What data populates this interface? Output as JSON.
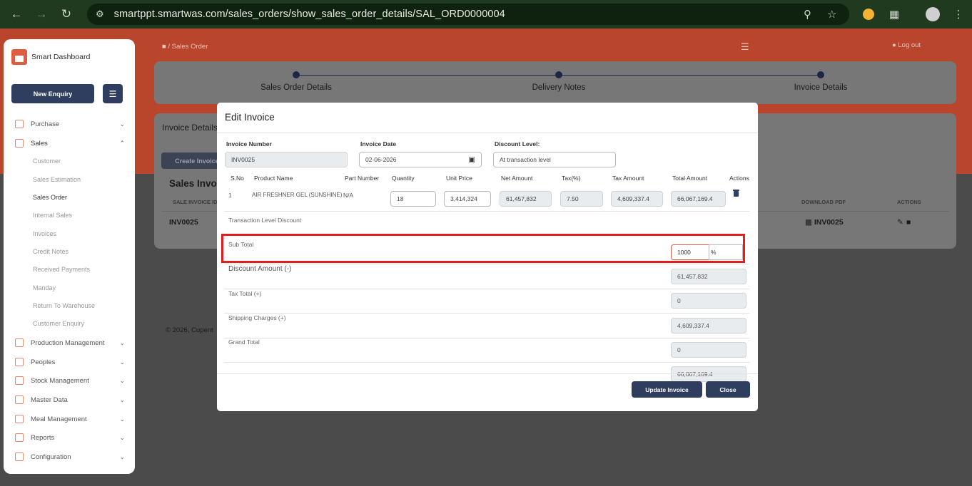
{
  "browser": {
    "url": "smartppt.smartwas.com/sales_orders/show_sales_order_details/SAL_ORD0000004"
  },
  "sidebar": {
    "brand": "Smart Dashboard",
    "new_enquiry": "New Enquiry",
    "menu": [
      {
        "label": "Purchase"
      },
      {
        "label": "Sales"
      },
      {
        "label": "Production Management"
      },
      {
        "label": "Peoples"
      },
      {
        "label": "Stock Management"
      },
      {
        "label": "Master Data"
      },
      {
        "label": "Meal Management"
      },
      {
        "label": "Reports"
      },
      {
        "label": "Configuration"
      }
    ],
    "sales_sub": [
      "Customer",
      "Sales Estimation",
      "Sales Order",
      "Internal Sales",
      "Invoices",
      "Credit Notes",
      "Received Payments",
      "Manday",
      "Return To Warehouse",
      "Customer Enquiry"
    ]
  },
  "topbar": {
    "breadcrumb_sep": "/",
    "breadcrumb": "Sales Order",
    "logout": "Log out"
  },
  "steps": [
    "Sales Order Details",
    "Delivery Notes",
    "Invoice Details"
  ],
  "invoice_card": {
    "title": "Invoice Details",
    "create_button": "Create Invoice",
    "sales_invoices_heading": "Sales Invoi",
    "col_sale_invoice_id": "SALE INVOICE ID",
    "col_download_pdf": "DOWNLOAD PDF",
    "col_actions": "ACTIONS",
    "row_id": "INV0025",
    "row_pdf": "INV0025"
  },
  "footer": {
    "copyright": "© 2026, ",
    "company": "Cupent"
  },
  "modal": {
    "title": "Edit Invoice",
    "invoice_number_label": "Invoice Number",
    "invoice_number": "INV0025",
    "invoice_date_label": "Invoice Date",
    "invoice_date": "02-06-2026",
    "discount_level_label": "Discount Level:",
    "discount_level": "At transaction level",
    "columns": [
      "S.No",
      "Product Name",
      "Part Number",
      "Quantity",
      "Unit Price",
      "Net Amount",
      "Tax(%)",
      "Tax Amount",
      "Total Amount",
      "Actions"
    ],
    "item": {
      "sno": "1",
      "product": "AIR FRESHNER GEL (SUNSHINE)",
      "part": "N/A",
      "quantity": "18",
      "unit_price": "3,414,324",
      "net_amount": "61,457,832",
      "tax_pct": "7.50",
      "tax_amount": "4,609,337.4",
      "total_amount": "66,067,169.4"
    },
    "transaction_discount_label": "Transaction Level Discount",
    "transaction_discount_value": "1000",
    "transaction_discount_unit": "%",
    "sub_total_label": "Sub Total",
    "sub_total": "61,457,832",
    "discount_amount_label": "Discount Amount (-)",
    "discount_amount": "0",
    "tax_total_label": "Tax Total (+)",
    "tax_total": "4,609,337.4",
    "shipping_label": "Shipping Charges (+)",
    "shipping": "0",
    "grand_total_label": "Grand Total",
    "grand_total": "66,067,169.4",
    "update_button": "Update Invoice",
    "close_button": "Close"
  }
}
